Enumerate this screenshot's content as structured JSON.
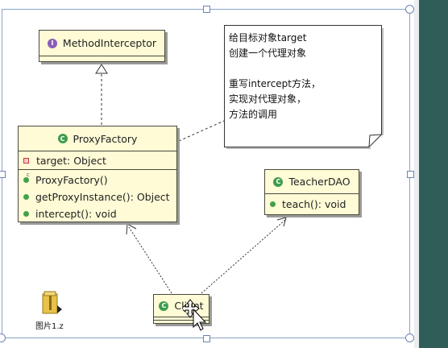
{
  "diagram": {
    "method_interceptor": {
      "name": "MethodInterceptor",
      "icon": "interface-icon"
    },
    "proxy_factory": {
      "name": "ProxyFactory",
      "fields": [
        "target: Object"
      ],
      "methods": [
        "ProxyFactory()",
        "getProxyInstance(): Object",
        "intercept(): void"
      ]
    },
    "teacher_dao": {
      "name": "TeacherDAO",
      "methods": [
        "teach(): void"
      ]
    },
    "client": {
      "name": "Client"
    },
    "note": "给目标对象target\n创建一个代理对象\n\n重写intercept方法，\n实现对代理对象，\n方法的调用"
  },
  "desktop": {
    "file_label": "图片1.z"
  },
  "colors": {
    "class_fill": "#fefbd6",
    "class_border": "#4a4a3a",
    "class_icon": "#3f9c4f",
    "interface_icon": "#8a5fb7",
    "selection_handles": "#6a86b0",
    "side_strip": "#2f5d57"
  }
}
